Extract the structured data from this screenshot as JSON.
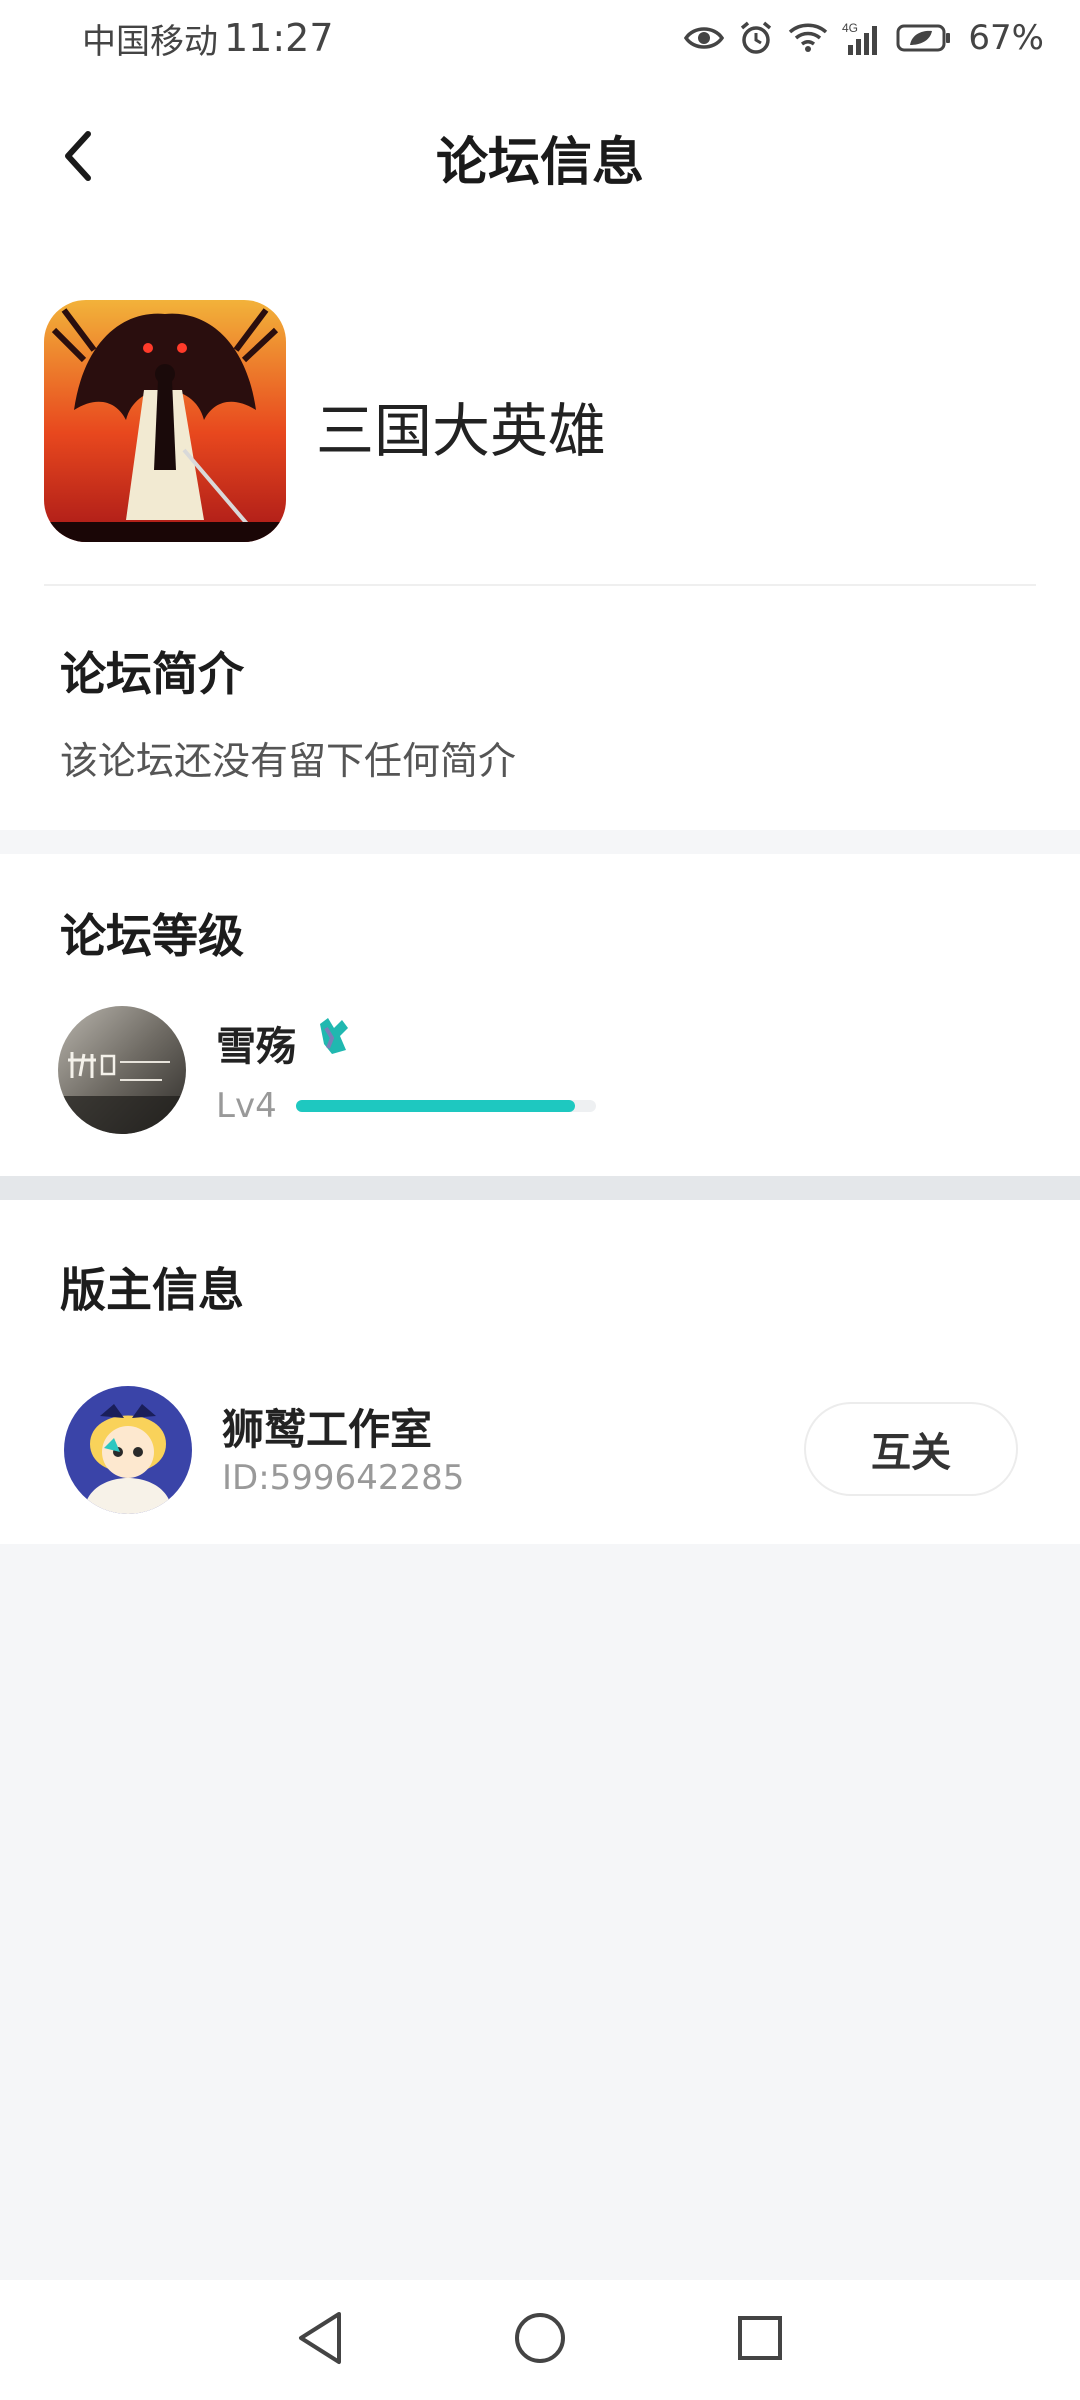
{
  "status_bar": {
    "carrier": "中国移动",
    "time": "11:27",
    "battery": "67%",
    "icons": [
      "eye-icon",
      "alarm-icon",
      "wifi-icon",
      "signal-4g-icon",
      "battery-icon"
    ]
  },
  "header": {
    "title": "论坛信息",
    "back_icon": "chevron-left-icon"
  },
  "forum": {
    "name": "三国大英雄",
    "intro_title": "论坛简介",
    "intro_text": "该论坛还没有留下任何简介"
  },
  "level": {
    "title": "论坛等级",
    "user_name": "雪殇",
    "level_label": "Lv4",
    "progress": 0.93,
    "accent": "#1ec8c0"
  },
  "moderator": {
    "title": "版主信息",
    "name": "狮鹫工作室",
    "id": "ID:599642285",
    "follow_label": "互关"
  },
  "nav": {
    "icons": [
      "back-triangle-icon",
      "home-circle-icon",
      "recent-square-icon"
    ]
  }
}
